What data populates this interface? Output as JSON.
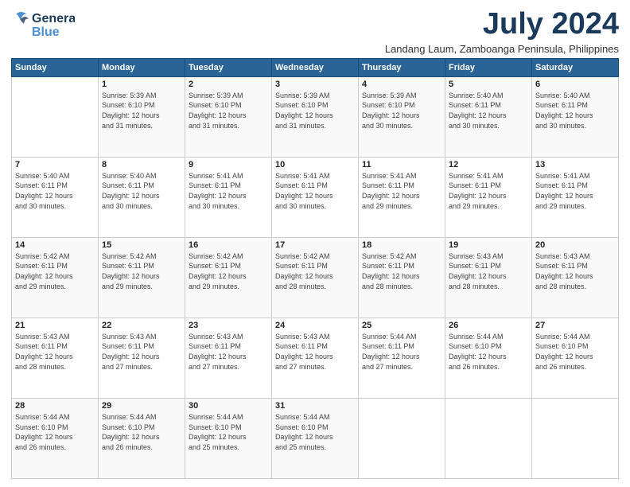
{
  "logo": {
    "line1": "General",
    "line2": "Blue"
  },
  "title": "July 2024",
  "location": "Landang Laum, Zamboanga Peninsula, Philippines",
  "days_of_week": [
    "Sunday",
    "Monday",
    "Tuesday",
    "Wednesday",
    "Thursday",
    "Friday",
    "Saturday"
  ],
  "weeks": [
    [
      {
        "day": "",
        "info": ""
      },
      {
        "day": "1",
        "info": "Sunrise: 5:39 AM\nSunset: 6:10 PM\nDaylight: 12 hours\nand 31 minutes."
      },
      {
        "day": "2",
        "info": "Sunrise: 5:39 AM\nSunset: 6:10 PM\nDaylight: 12 hours\nand 31 minutes."
      },
      {
        "day": "3",
        "info": "Sunrise: 5:39 AM\nSunset: 6:10 PM\nDaylight: 12 hours\nand 31 minutes."
      },
      {
        "day": "4",
        "info": "Sunrise: 5:39 AM\nSunset: 6:10 PM\nDaylight: 12 hours\nand 30 minutes."
      },
      {
        "day": "5",
        "info": "Sunrise: 5:40 AM\nSunset: 6:11 PM\nDaylight: 12 hours\nand 30 minutes."
      },
      {
        "day": "6",
        "info": "Sunrise: 5:40 AM\nSunset: 6:11 PM\nDaylight: 12 hours\nand 30 minutes."
      }
    ],
    [
      {
        "day": "7",
        "info": ""
      },
      {
        "day": "8",
        "info": "Sunrise: 5:40 AM\nSunset: 6:11 PM\nDaylight: 12 hours\nand 30 minutes."
      },
      {
        "day": "9",
        "info": "Sunrise: 5:41 AM\nSunset: 6:11 PM\nDaylight: 12 hours\nand 30 minutes."
      },
      {
        "day": "10",
        "info": "Sunrise: 5:41 AM\nSunset: 6:11 PM\nDaylight: 12 hours\nand 30 minutes."
      },
      {
        "day": "11",
        "info": "Sunrise: 5:41 AM\nSunset: 6:11 PM\nDaylight: 12 hours\nand 29 minutes."
      },
      {
        "day": "12",
        "info": "Sunrise: 5:41 AM\nSunset: 6:11 PM\nDaylight: 12 hours\nand 29 minutes."
      },
      {
        "day": "13",
        "info": "Sunrise: 5:41 AM\nSunset: 6:11 PM\nDaylight: 12 hours\nand 29 minutes."
      }
    ],
    [
      {
        "day": "14",
        "info": ""
      },
      {
        "day": "15",
        "info": "Sunrise: 5:42 AM\nSunset: 6:11 PM\nDaylight: 12 hours\nand 29 minutes."
      },
      {
        "day": "16",
        "info": "Sunrise: 5:42 AM\nSunset: 6:11 PM\nDaylight: 12 hours\nand 29 minutes."
      },
      {
        "day": "17",
        "info": "Sunrise: 5:42 AM\nSunset: 6:11 PM\nDaylight: 12 hours\nand 28 minutes."
      },
      {
        "day": "18",
        "info": "Sunrise: 5:42 AM\nSunset: 6:11 PM\nDaylight: 12 hours\nand 28 minutes."
      },
      {
        "day": "19",
        "info": "Sunrise: 5:43 AM\nSunset: 6:11 PM\nDaylight: 12 hours\nand 28 minutes."
      },
      {
        "day": "20",
        "info": "Sunrise: 5:43 AM\nSunset: 6:11 PM\nDaylight: 12 hours\nand 28 minutes."
      }
    ],
    [
      {
        "day": "21",
        "info": ""
      },
      {
        "day": "22",
        "info": "Sunrise: 5:43 AM\nSunset: 6:11 PM\nDaylight: 12 hours\nand 27 minutes."
      },
      {
        "day": "23",
        "info": "Sunrise: 5:43 AM\nSunset: 6:11 PM\nDaylight: 12 hours\nand 27 minutes."
      },
      {
        "day": "24",
        "info": "Sunrise: 5:43 AM\nSunset: 6:11 PM\nDaylight: 12 hours\nand 27 minutes."
      },
      {
        "day": "25",
        "info": "Sunrise: 5:44 AM\nSunset: 6:11 PM\nDaylight: 12 hours\nand 27 minutes."
      },
      {
        "day": "26",
        "info": "Sunrise: 5:44 AM\nSunset: 6:10 PM\nDaylight: 12 hours\nand 26 minutes."
      },
      {
        "day": "27",
        "info": "Sunrise: 5:44 AM\nSunset: 6:10 PM\nDaylight: 12 hours\nand 26 minutes."
      }
    ],
    [
      {
        "day": "28",
        "info": "Sunrise: 5:44 AM\nSunset: 6:10 PM\nDaylight: 12 hours\nand 26 minutes."
      },
      {
        "day": "29",
        "info": "Sunrise: 5:44 AM\nSunset: 6:10 PM\nDaylight: 12 hours\nand 26 minutes."
      },
      {
        "day": "30",
        "info": "Sunrise: 5:44 AM\nSunset: 6:10 PM\nDaylight: 12 hours\nand 25 minutes."
      },
      {
        "day": "31",
        "info": "Sunrise: 5:44 AM\nSunset: 6:10 PM\nDaylight: 12 hours\nand 25 minutes."
      },
      {
        "day": "",
        "info": ""
      },
      {
        "day": "",
        "info": ""
      },
      {
        "day": "",
        "info": ""
      }
    ]
  ],
  "week7_sun_info": "Sunrise: 5:40 AM\nSunset: 6:11 PM\nDaylight: 12 hours\nand 30 minutes.",
  "week14_sun_info": "Sunrise: 5:42 AM\nSunset: 6:11 PM\nDaylight: 12 hours\nand 29 minutes.",
  "week21_sun_info": "Sunrise: 5:43 AM\nSunset: 6:11 PM\nDaylight: 12 hours\nand 28 minutes."
}
